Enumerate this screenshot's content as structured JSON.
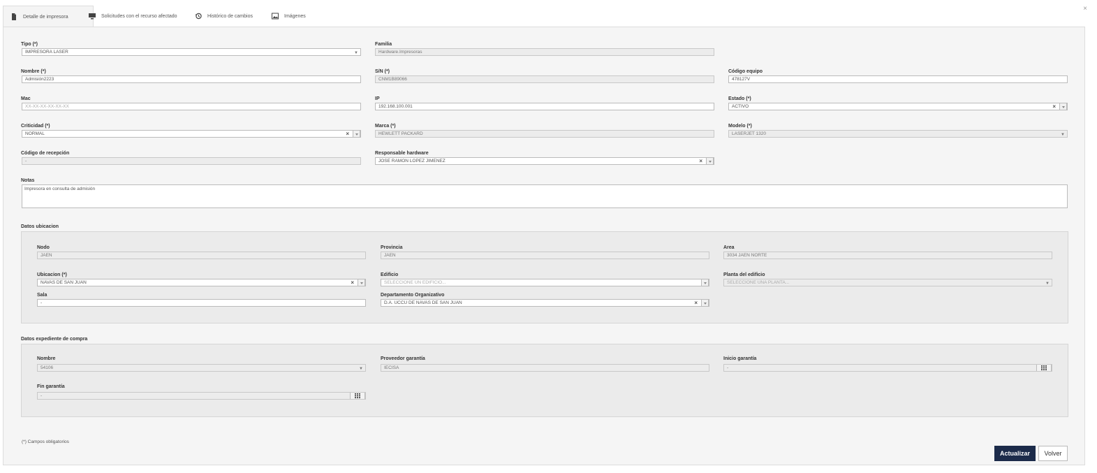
{
  "tabs": [
    {
      "label": "Detalle de impresora",
      "icon": "document-icon"
    },
    {
      "label": "Solicitudes con el recurso afectado",
      "icon": "monitor-icon"
    },
    {
      "label": "Histórico de cambios",
      "icon": "history-icon"
    },
    {
      "label": "Imágenes",
      "icon": "image-icon"
    }
  ],
  "close": "×",
  "form": {
    "tipo": {
      "label": "Tipo (*)",
      "value": "IMPRESORA LASER"
    },
    "familia": {
      "label": "Familia",
      "value": "Hardware.Impresoras"
    },
    "nombre": {
      "label": "Nombre (*)",
      "value": "Admisión2223"
    },
    "sn": {
      "label": "S/N (*)",
      "value": "CNM1B89066"
    },
    "codigo_equipo": {
      "label": "Código equipo",
      "value": "478127V"
    },
    "mac": {
      "label": "Mac",
      "placeholder": "XX-XX-XX-XX-XX-XX"
    },
    "ip": {
      "label": "IP",
      "value": "192.168.100.001"
    },
    "estado": {
      "label": "Estado (*)",
      "value": "ACTIVO"
    },
    "criticidad": {
      "label": "Criticidad (*)",
      "value": "NORMAL"
    },
    "marca": {
      "label": "Marca (*)",
      "value": "HEWLETT PACKARD"
    },
    "modelo": {
      "label": "Modelo (*)",
      "value": "LASERJET 1320"
    },
    "codigo_recepcion": {
      "label": "Código de recepción",
      "value": "-"
    },
    "responsable": {
      "label": "Responsable hardware",
      "value": "JOSE RAMON LOPEZ JIMENEZ"
    },
    "notas": {
      "label": "Notas",
      "value": "Impresora en consulta de admisión"
    }
  },
  "ubicacion": {
    "title": "Datos ubicacion",
    "nodo": {
      "label": "Nodo",
      "value": "JAEN"
    },
    "provincia": {
      "label": "Provincia",
      "value": "JAEN"
    },
    "area": {
      "label": "Area",
      "value": "3034 JAEN NORTE"
    },
    "ubicacion": {
      "label": "Ubicacion (*)",
      "value": "NAVAS DE SAN JUAN"
    },
    "edificio": {
      "label": "Edificio",
      "placeholder": "SELECCIONE UN EDIFICIO..."
    },
    "planta": {
      "label": "Planta del edificio",
      "placeholder": "SELECCIONE UNA PLANTA..."
    },
    "sala": {
      "label": "Sala",
      "value": "-"
    },
    "departamento": {
      "label": "Departamento Organizativo",
      "value": "D.A. UCCU DE NAVAS DE SAN JUAN"
    }
  },
  "expediente": {
    "title": "Datos expediente de compra",
    "nombre": {
      "label": "Nombre",
      "value": "54106"
    },
    "proveedor": {
      "label": "Proveedor garantía",
      "value": "IECISA"
    },
    "inicio": {
      "label": "Inicio garantía",
      "value": "-"
    },
    "fin": {
      "label": "Fin garantía",
      "value": "-"
    }
  },
  "footnote": "(*) Campos obligatorios",
  "buttons": {
    "update": "Actualizar",
    "back": "Volver"
  }
}
